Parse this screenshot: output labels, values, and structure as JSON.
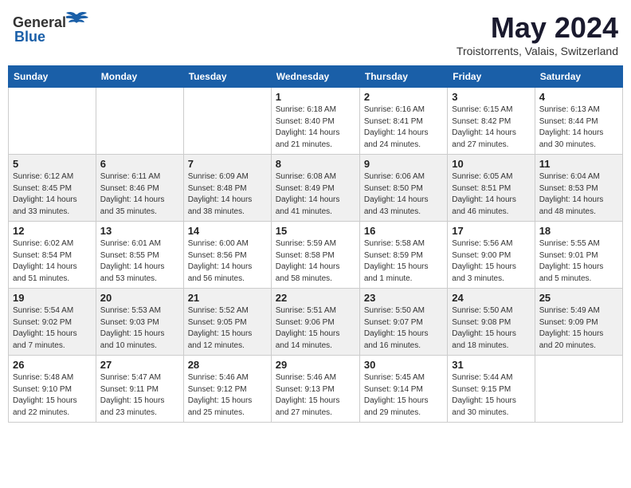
{
  "header": {
    "logo_general": "General",
    "logo_blue": "Blue",
    "title": "May 2024",
    "subtitle": "Troistorrents, Valais, Switzerland"
  },
  "weekdays": [
    "Sunday",
    "Monday",
    "Tuesday",
    "Wednesday",
    "Thursday",
    "Friday",
    "Saturday"
  ],
  "weeks": [
    [
      {
        "day": "",
        "info": ""
      },
      {
        "day": "",
        "info": ""
      },
      {
        "day": "",
        "info": ""
      },
      {
        "day": "1",
        "info": "Sunrise: 6:18 AM\nSunset: 8:40 PM\nDaylight: 14 hours\nand 21 minutes."
      },
      {
        "day": "2",
        "info": "Sunrise: 6:16 AM\nSunset: 8:41 PM\nDaylight: 14 hours\nand 24 minutes."
      },
      {
        "day": "3",
        "info": "Sunrise: 6:15 AM\nSunset: 8:42 PM\nDaylight: 14 hours\nand 27 minutes."
      },
      {
        "day": "4",
        "info": "Sunrise: 6:13 AM\nSunset: 8:44 PM\nDaylight: 14 hours\nand 30 minutes."
      }
    ],
    [
      {
        "day": "5",
        "info": "Sunrise: 6:12 AM\nSunset: 8:45 PM\nDaylight: 14 hours\nand 33 minutes."
      },
      {
        "day": "6",
        "info": "Sunrise: 6:11 AM\nSunset: 8:46 PM\nDaylight: 14 hours\nand 35 minutes."
      },
      {
        "day": "7",
        "info": "Sunrise: 6:09 AM\nSunset: 8:48 PM\nDaylight: 14 hours\nand 38 minutes."
      },
      {
        "day": "8",
        "info": "Sunrise: 6:08 AM\nSunset: 8:49 PM\nDaylight: 14 hours\nand 41 minutes."
      },
      {
        "day": "9",
        "info": "Sunrise: 6:06 AM\nSunset: 8:50 PM\nDaylight: 14 hours\nand 43 minutes."
      },
      {
        "day": "10",
        "info": "Sunrise: 6:05 AM\nSunset: 8:51 PM\nDaylight: 14 hours\nand 46 minutes."
      },
      {
        "day": "11",
        "info": "Sunrise: 6:04 AM\nSunset: 8:53 PM\nDaylight: 14 hours\nand 48 minutes."
      }
    ],
    [
      {
        "day": "12",
        "info": "Sunrise: 6:02 AM\nSunset: 8:54 PM\nDaylight: 14 hours\nand 51 minutes."
      },
      {
        "day": "13",
        "info": "Sunrise: 6:01 AM\nSunset: 8:55 PM\nDaylight: 14 hours\nand 53 minutes."
      },
      {
        "day": "14",
        "info": "Sunrise: 6:00 AM\nSunset: 8:56 PM\nDaylight: 14 hours\nand 56 minutes."
      },
      {
        "day": "15",
        "info": "Sunrise: 5:59 AM\nSunset: 8:58 PM\nDaylight: 14 hours\nand 58 minutes."
      },
      {
        "day": "16",
        "info": "Sunrise: 5:58 AM\nSunset: 8:59 PM\nDaylight: 15 hours\nand 1 minute."
      },
      {
        "day": "17",
        "info": "Sunrise: 5:56 AM\nSunset: 9:00 PM\nDaylight: 15 hours\nand 3 minutes."
      },
      {
        "day": "18",
        "info": "Sunrise: 5:55 AM\nSunset: 9:01 PM\nDaylight: 15 hours\nand 5 minutes."
      }
    ],
    [
      {
        "day": "19",
        "info": "Sunrise: 5:54 AM\nSunset: 9:02 PM\nDaylight: 15 hours\nand 7 minutes."
      },
      {
        "day": "20",
        "info": "Sunrise: 5:53 AM\nSunset: 9:03 PM\nDaylight: 15 hours\nand 10 minutes."
      },
      {
        "day": "21",
        "info": "Sunrise: 5:52 AM\nSunset: 9:05 PM\nDaylight: 15 hours\nand 12 minutes."
      },
      {
        "day": "22",
        "info": "Sunrise: 5:51 AM\nSunset: 9:06 PM\nDaylight: 15 hours\nand 14 minutes."
      },
      {
        "day": "23",
        "info": "Sunrise: 5:50 AM\nSunset: 9:07 PM\nDaylight: 15 hours\nand 16 minutes."
      },
      {
        "day": "24",
        "info": "Sunrise: 5:50 AM\nSunset: 9:08 PM\nDaylight: 15 hours\nand 18 minutes."
      },
      {
        "day": "25",
        "info": "Sunrise: 5:49 AM\nSunset: 9:09 PM\nDaylight: 15 hours\nand 20 minutes."
      }
    ],
    [
      {
        "day": "26",
        "info": "Sunrise: 5:48 AM\nSunset: 9:10 PM\nDaylight: 15 hours\nand 22 minutes."
      },
      {
        "day": "27",
        "info": "Sunrise: 5:47 AM\nSunset: 9:11 PM\nDaylight: 15 hours\nand 23 minutes."
      },
      {
        "day": "28",
        "info": "Sunrise: 5:46 AM\nSunset: 9:12 PM\nDaylight: 15 hours\nand 25 minutes."
      },
      {
        "day": "29",
        "info": "Sunrise: 5:46 AM\nSunset: 9:13 PM\nDaylight: 15 hours\nand 27 minutes."
      },
      {
        "day": "30",
        "info": "Sunrise: 5:45 AM\nSunset: 9:14 PM\nDaylight: 15 hours\nand 29 minutes."
      },
      {
        "day": "31",
        "info": "Sunrise: 5:44 AM\nSunset: 9:15 PM\nDaylight: 15 hours\nand 30 minutes."
      },
      {
        "day": "",
        "info": ""
      }
    ]
  ]
}
